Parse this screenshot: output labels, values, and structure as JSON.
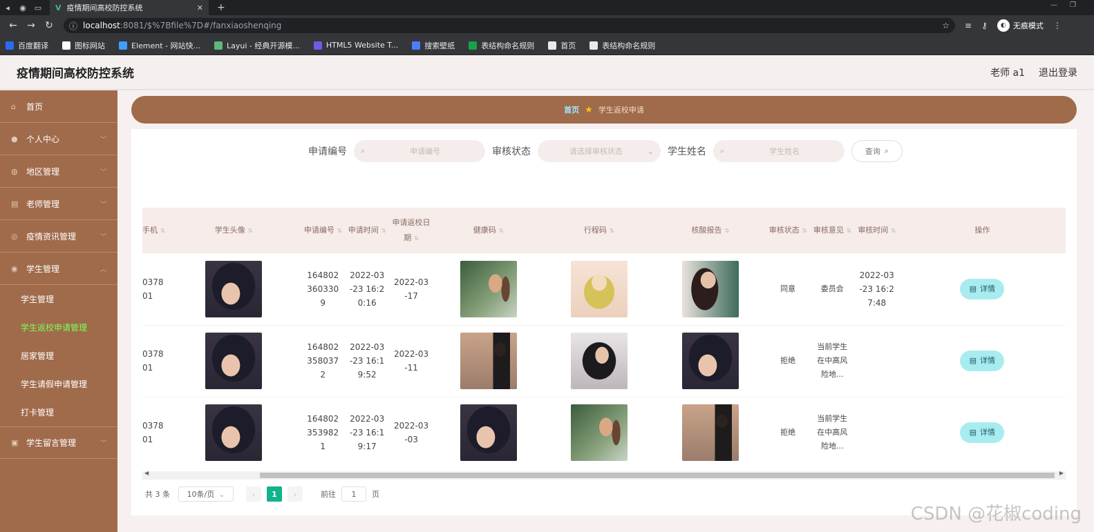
{
  "browser": {
    "tab_title": "疫情期间高校防控系统",
    "url_host": "localhost",
    "url_path": ":8081/$%7Bfile%7D#/fanxiaoshenqing",
    "incognito_label": "无痕模式",
    "bookmarks": [
      {
        "label": "百度翻译",
        "color": "#2a6bf2"
      },
      {
        "label": "图标网站",
        "color": "#ffffff"
      },
      {
        "label": "Element - 网站快...",
        "color": "#409eff"
      },
      {
        "label": "Layui - 经典开源模...",
        "color": "#5fb878"
      },
      {
        "label": "HTML5 Website T...",
        "color": "#6c5ce7"
      },
      {
        "label": "搜索壁纸",
        "color": "#4f7cff"
      },
      {
        "label": "表结构命名规则",
        "color": "#16a34a"
      },
      {
        "label": "首页",
        "color": "#e8eaed"
      },
      {
        "label": "表结构命名规则",
        "color": "#e8eaed"
      }
    ]
  },
  "header": {
    "title": "疫情期间高校防控系统",
    "user": "老师 a1",
    "logout": "退出登录"
  },
  "sidebar": {
    "items": [
      {
        "label": "首页",
        "icon": "home-icon"
      },
      {
        "label": "个人中心",
        "icon": "user-icon"
      },
      {
        "label": "地区管理",
        "icon": "location-icon"
      },
      {
        "label": "老师管理",
        "icon": "document-icon"
      },
      {
        "label": "疫情资讯管理",
        "icon": "info-icon"
      },
      {
        "label": "学生管理",
        "icon": "people-icon"
      }
    ],
    "sub_items": [
      {
        "label": "学生管理",
        "active": false
      },
      {
        "label": "学生返校申请管理",
        "active": true
      },
      {
        "label": "居家管理",
        "active": false
      },
      {
        "label": "学生请假申请管理",
        "active": false
      },
      {
        "label": "打卡管理",
        "active": false
      }
    ],
    "last_item": {
      "label": "学生留言管理",
      "icon": "message-icon"
    }
  },
  "breadcrumb": {
    "home": "首页",
    "current": "学生返校申请"
  },
  "search": {
    "label_no": "申请编号",
    "placeholder_no": "申请编号",
    "label_status": "审核状态",
    "placeholder_status": "请选择审核状态",
    "label_name": "学生姓名",
    "placeholder_name": "学生姓名",
    "query_button": "查询"
  },
  "table": {
    "headers": [
      "手机",
      "学生头像",
      "申请编号",
      "申请时间",
      "申请返校日期",
      "健康码",
      "行程码",
      "核酸报告",
      "审核状态",
      "审核意见",
      "审核时间",
      "操作"
    ],
    "detail_label": "详情",
    "rows": [
      {
        "phone": "0378 01",
        "apply_no": "1648023603309",
        "apply_time": "2022-03-23 16:20:16",
        "return_date": "2022-03-17",
        "status": "同意",
        "opinion": "委员会",
        "review_time": "2022-03-23 16:27:48",
        "images": [
          "face",
          "girl",
          "cartoon",
          "art"
        ]
      },
      {
        "phone": "0378 01",
        "apply_no": "1648023580372",
        "apply_time": "2022-03-23 16:19:52",
        "return_date": "2022-03-11",
        "status": "拒绝",
        "opinion": "当前学生在中高风险地...",
        "review_time": "",
        "images": [
          "face",
          "room",
          "pillow",
          "face"
        ]
      },
      {
        "phone": "0378 01",
        "apply_no": "1648023539821",
        "apply_time": "2022-03-23 16:19:17",
        "return_date": "2022-03-03",
        "status": "拒绝",
        "opinion": "当前学生在中高风险地...",
        "review_time": "",
        "images": [
          "face",
          "face",
          "girl",
          "room"
        ]
      }
    ]
  },
  "pagination": {
    "total": "共 3 条",
    "page_size": "10条/页",
    "current_page": "1",
    "goto_label": "前往",
    "goto_value": "1",
    "page_unit": "页"
  },
  "watermark": "CSDN @花椒coding"
}
